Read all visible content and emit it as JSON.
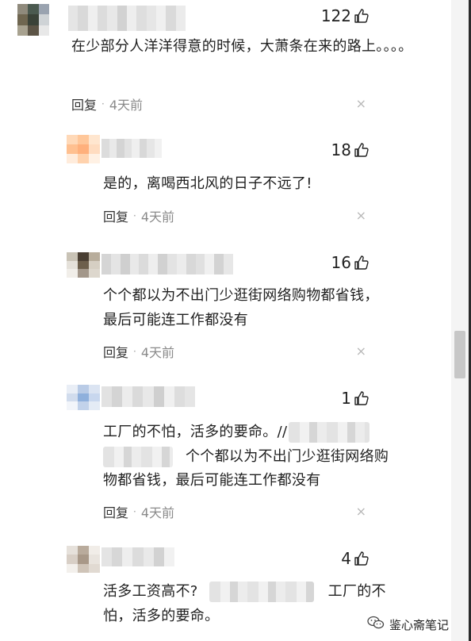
{
  "comments": [
    {
      "likes": "122",
      "text": "在少部分人洋洋得意的时候，大萧条在来的路上。。。。",
      "reply_label": "回复",
      "dot": "·",
      "time": "4天前",
      "close": "×",
      "avatar_colors": [
        "#8f8a7c",
        "#4b5a50",
        "#9aa3b0",
        "#6f6650",
        "#3a4238",
        "#cfd3d6",
        "#a8a290",
        "#5c5446",
        "#e8e8e8"
      ],
      "username_colors": [
        "#e5e5e5",
        "#d9d9d9",
        "#efefef",
        "#dcdcdc",
        "#e8e8e8",
        "#d2d2d2",
        "#eeeeee",
        "#dedede",
        "#e6e6e6",
        "#f0f0f0",
        "#dadada",
        "#ebebeb"
      ]
    },
    {
      "likes": "18",
      "text": "是的，离喝西北风的日子不远了!",
      "reply_label": "回复",
      "dot": "·",
      "time": "4天前",
      "close": "×",
      "avatar_colors": [
        "#ffd9b8",
        "#ffc79a",
        "#ffe6cf",
        "#ffc090",
        "#ffb07c",
        "#ffdcc0",
        "#ffecdc",
        "#ffd2ad",
        "#fff1e4"
      ],
      "username_colors": [
        "#dcdcdc",
        "#e9e9e9",
        "#d4d4d4",
        "#e2e2e2",
        "#efefef",
        "#d8d8d8",
        "#e6e6e6",
        "#f1f1f1"
      ]
    },
    {
      "likes": "16",
      "text_lines": [
        "个个都以为不出门少逛街网络购物都省钱，",
        "最后可能连工作都没有"
      ],
      "reply_label": "回复",
      "dot": "·",
      "time": "4天前",
      "close": "×",
      "avatar_colors": [
        "#c9c3b6",
        "#4a3f33",
        "#b8ad9c",
        "#e5e1da",
        "#6d5f4c",
        "#d6cfc3",
        "#f1eee9",
        "#a3978a",
        "#ddd7cd"
      ],
      "username_colors": [
        "#d5d5d5",
        "#e4e4e4",
        "#cfcfcf",
        "#e9e9e9",
        "#dbdbdb",
        "#eeeeee",
        "#d1d1d1",
        "#e3e3e3",
        "#ececec",
        "#d8d8d8",
        "#e0e0e0",
        "#f0f0f0",
        "#d3d3d3",
        "#e7e7e7"
      ]
    },
    {
      "likes": "1",
      "text_a": "工厂的不怕，活多的要命。//",
      "text_b": "个个都以为不出门少逛街网络购",
      "text_c": "物都省钱，最后可能连工作都没有",
      "reply_label": "回复",
      "dot": "·",
      "time": "4天前",
      "close": "×",
      "avatar_colors": [
        "#e9eef6",
        "#b9cbe6",
        "#dbe4f2",
        "#d1dced",
        "#8fb0dc",
        "#c8d7ee",
        "#f2f5fa",
        "#c2d2ea",
        "#e4ebf5"
      ],
      "username_colors": [
        "#e2e2e2",
        "#d4d4d4",
        "#ececec",
        "#dadada",
        "#e8e8e8",
        "#cfcfcf",
        "#f0f0f0",
        "#dddddd",
        "#e5e5e5"
      ]
    },
    {
      "likes": "4",
      "text_a": "活多工资高不?",
      "text_b": "工厂的不",
      "text_c": "怕，活多的要命。",
      "avatar_colors": [
        "#e6e1db",
        "#b9ab9c",
        "#f1ede8",
        "#d8cfc6",
        "#a89888",
        "#e9e4de",
        "#f3f0ec",
        "#cfc4b8",
        "#e1dad2"
      ],
      "username_colors": [
        "#e4e4e4",
        "#d7d7d7",
        "#eeeeee",
        "#dcdcdc",
        "#e9e9e9",
        "#d2d2d2",
        "#f1f1f1"
      ]
    }
  ],
  "watermark": {
    "text": "鉴心斋笔记"
  },
  "colors": {
    "text": "#1f1f1f",
    "time": "#8a8a8a",
    "close": "#b8b8b8"
  }
}
